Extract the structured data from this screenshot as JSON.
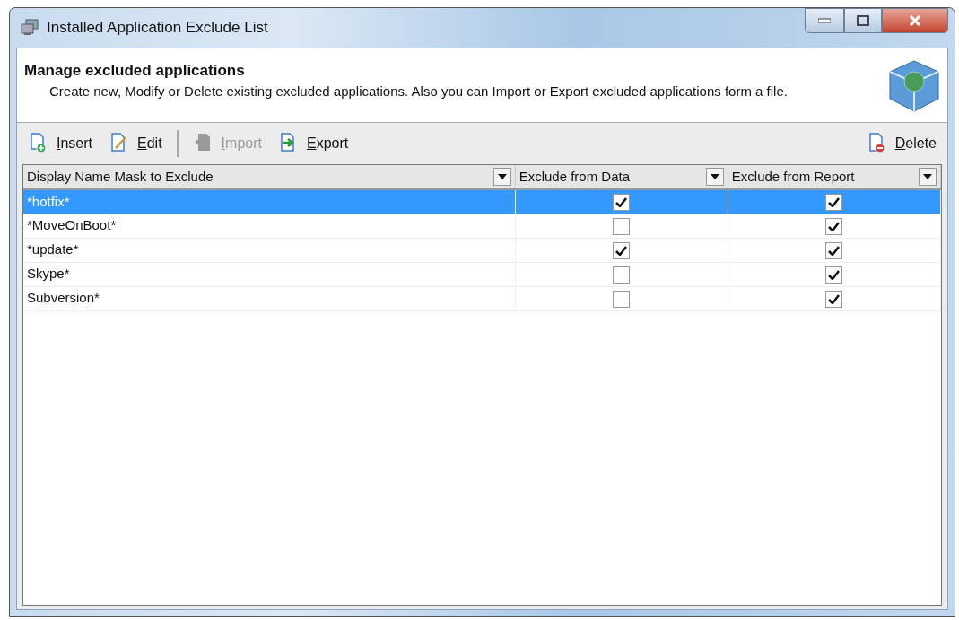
{
  "window": {
    "title": "Installed Application Exclude List"
  },
  "header": {
    "title": "Manage excluded applications",
    "description": "Create new, Modify or Delete existing excluded applications. Also you can Import or Export excluded applications form a file."
  },
  "toolbar": {
    "left": [
      {
        "kind": "insert",
        "label": "Insert",
        "disabled": false
      },
      {
        "kind": "edit",
        "label": "Edit",
        "disabled": false
      },
      {
        "kind": "separator"
      },
      {
        "kind": "import",
        "label": "Import",
        "disabled": true
      },
      {
        "kind": "export",
        "label": "Export",
        "disabled": false
      }
    ],
    "right": [
      {
        "kind": "delete",
        "label": "Delete",
        "disabled": false
      }
    ]
  },
  "table": {
    "columns": [
      "Display Name Mask to Exclude",
      "Exclude from Data",
      "Exclude from Report"
    ],
    "rows": [
      {
        "name": "*hotfix*",
        "exclude_from_data": true,
        "exclude_from_report": true,
        "selected": true
      },
      {
        "name": "*MoveOnBoot*",
        "exclude_from_data": false,
        "exclude_from_report": true,
        "selected": false
      },
      {
        "name": "*update*",
        "exclude_from_data": true,
        "exclude_from_report": true,
        "selected": false
      },
      {
        "name": "Skype*",
        "exclude_from_data": false,
        "exclude_from_report": true,
        "selected": false
      },
      {
        "name": "Subversion*",
        "exclude_from_data": false,
        "exclude_from_report": true,
        "selected": false
      }
    ]
  }
}
